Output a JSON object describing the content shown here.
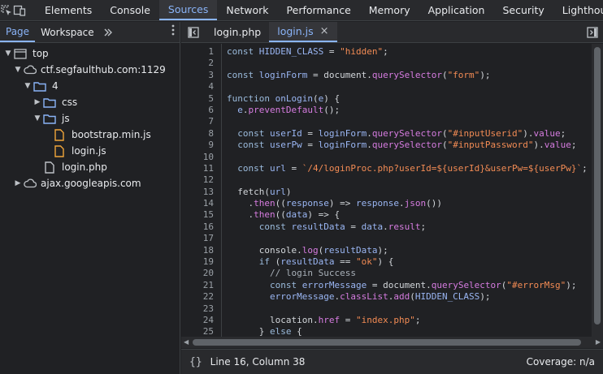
{
  "toolbar": {
    "panels": [
      "Elements",
      "Console",
      "Sources",
      "Network",
      "Performance",
      "Memory",
      "Application",
      "Security",
      "Lighthouse"
    ],
    "active_panel": "Sources"
  },
  "navigator": {
    "tabs": [
      "Page",
      "Workspace"
    ],
    "active_tab": "Page",
    "tree": {
      "top": "top",
      "domain": "ctf.segfaulthub.com:1129",
      "folder_4": "4",
      "folder_css": "css",
      "folder_js": "js",
      "file_bootstrap": "bootstrap.min.js",
      "file_login_js": "login.js",
      "file_login_php": "login.php",
      "domain2": "ajax.googleapis.com"
    }
  },
  "editor": {
    "tabs": [
      {
        "label": "login.php"
      },
      {
        "label": "login.js",
        "close": "×"
      }
    ],
    "active_tab": "login.js",
    "line_numbers": [
      "1",
      "2",
      "3",
      "4",
      "5",
      "6",
      "7",
      "8",
      "9",
      "10",
      "11",
      "12",
      "13",
      "14",
      "15",
      "16",
      "17",
      "18",
      "19",
      "20",
      "21",
      "22",
      "23",
      "24",
      "25"
    ],
    "code": [
      "const HIDDEN_CLASS = \"hidden\";",
      "",
      "const loginForm = document.querySelector(\"form\");",
      "",
      "function onLogin(e) {",
      "  e.preventDefault();",
      "",
      "  const userId = loginForm.querySelector(\"#inputUserid\").value;",
      "  const userPw = loginForm.querySelector(\"#inputPassword\").value;",
      "",
      "  const url = `/4/loginProc.php?userId=${userId}&userPw=${userPw}`;",
      "",
      "  fetch(url)",
      "    .then((response) => response.json())",
      "    .then((data) => {",
      "      const resultData = data.result;",
      "",
      "      console.log(resultData);",
      "      if (resultData == \"ok\") {",
      "        // login Success",
      "        const errorMessage = document.querySelector(\"#errorMsg\");",
      "        errorMessage.classList.add(HIDDEN_CLASS);",
      "",
      "        location.href = \"index.php\";",
      "      } else {"
    ]
  },
  "status": {
    "braces": "{}",
    "position": "Line 16, Column 38",
    "coverage": "Coverage: n/a"
  },
  "colors": {
    "accent": "#8ab4f8",
    "folder": "#8ab4f8",
    "js_file": "#f0a53a",
    "keyword": "#9bbbdc",
    "string": "#f28b54",
    "property": "#d67ce0"
  }
}
